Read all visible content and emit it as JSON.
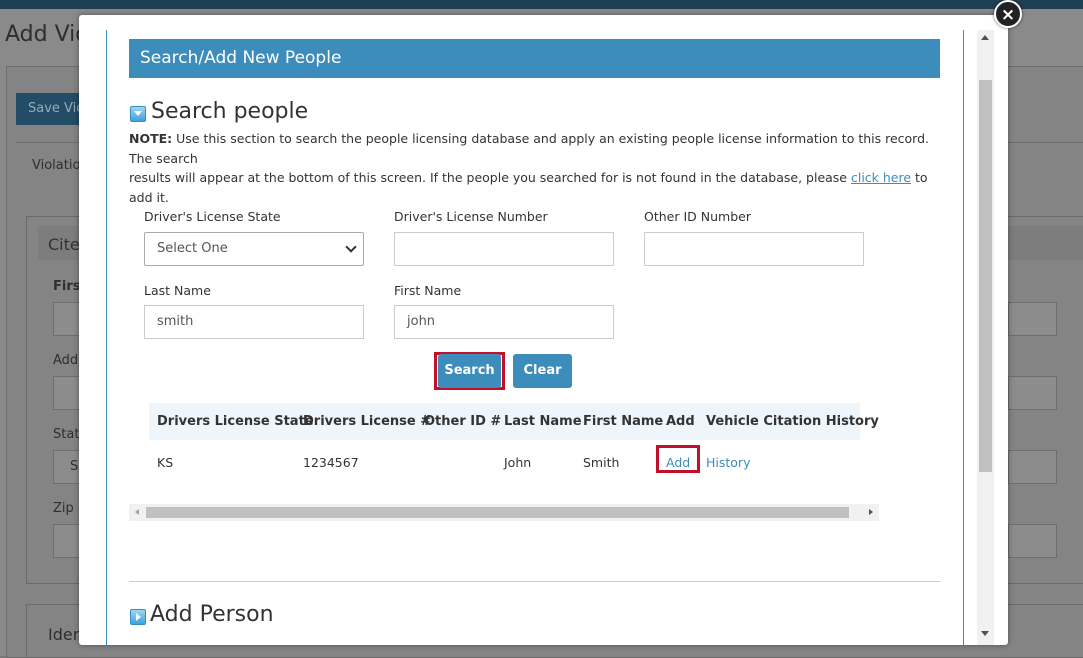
{
  "background": {
    "title": "Add Vio",
    "save_button": "Save Vio",
    "tab_violation": "Violatio",
    "cite_header": "Cite",
    "first_label": "First",
    "addr_label": "Addr",
    "state_label": "State",
    "state_value": "S",
    "zip_label": "Zip",
    "iden_header": "Iden"
  },
  "modal": {
    "close_label": "×",
    "section_header": "Search/Add New People",
    "search_heading": "Search people",
    "note_label": "NOTE:",
    "note_text_1": " Use this section to search the people licensing database and apply an existing people license information to this record. The search",
    "note_text_2": "results will appear at the bottom of this screen. If the people you searched for is not found in the database, please ",
    "note_link": "click here",
    "note_text_3": " to add it.",
    "form": {
      "dl_state_label": "Driver's License State",
      "dl_state_value": "Select One",
      "dl_number_label": "Driver's License Number",
      "dl_number_value": "",
      "other_id_label": "Other ID Number",
      "other_id_value": "",
      "last_name_label": "Last Name",
      "last_name_value": "smith",
      "first_name_label": "First Name",
      "first_name_value": "john"
    },
    "search_button": "Search",
    "clear_button": "Clear",
    "results": {
      "columns": [
        "Drivers License State",
        "Drivers License #",
        "Other ID #",
        "Last Name",
        "First Name",
        "Add",
        "Vehicle Citation History"
      ],
      "rows": [
        {
          "state": "KS",
          "license": "1234567",
          "other_id": "",
          "last_name": "John",
          "first_name": "Smith",
          "add": "Add",
          "history": "History"
        }
      ]
    },
    "add_person_heading": "Add Person"
  },
  "colors": {
    "accent": "#3c8dbc",
    "highlight": "#c0102a"
  }
}
